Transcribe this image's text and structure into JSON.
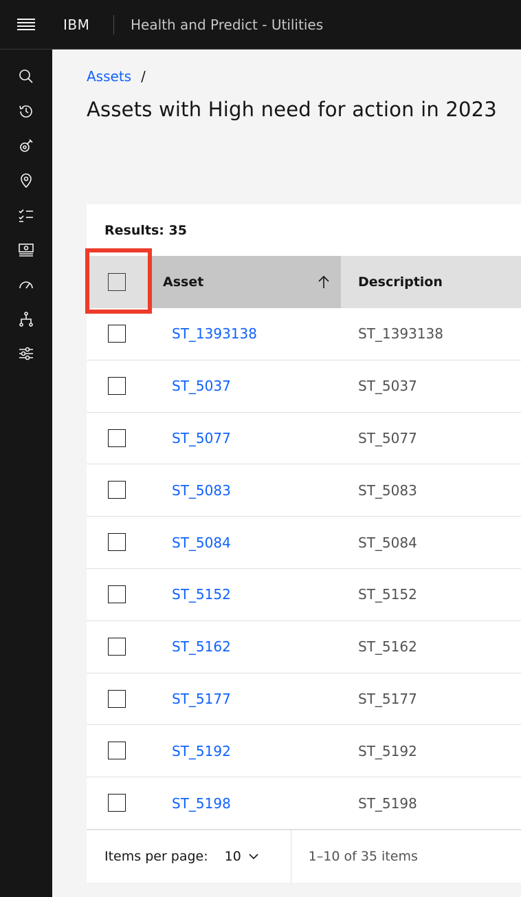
{
  "header": {
    "brand": "IBM",
    "app_title": "Health and Predict - Utilities"
  },
  "sidenav": {
    "items": [
      {
        "icon": "search-icon"
      },
      {
        "icon": "history-icon"
      },
      {
        "icon": "asset-icon"
      },
      {
        "icon": "location-icon"
      },
      {
        "icon": "checklist-icon"
      },
      {
        "icon": "dashboard-icon"
      },
      {
        "icon": "gauge-icon"
      },
      {
        "icon": "hierarchy-icon"
      },
      {
        "icon": "settings-adjust-icon"
      }
    ]
  },
  "breadcrumb": {
    "link": "Assets",
    "separator": "/"
  },
  "page": {
    "title": "Assets with High need for action in 2023"
  },
  "table": {
    "results_label": "Results: 35",
    "columns": [
      "Asset",
      "Description"
    ],
    "sort": "ascending",
    "rows": [
      {
        "asset": "ST_1393138",
        "description": "ST_1393138"
      },
      {
        "asset": "ST_5037",
        "description": "ST_5037"
      },
      {
        "asset": "ST_5077",
        "description": "ST_5077"
      },
      {
        "asset": "ST_5083",
        "description": "ST_5083"
      },
      {
        "asset": "ST_5084",
        "description": "ST_5084"
      },
      {
        "asset": "ST_5152",
        "description": "ST_5152"
      },
      {
        "asset": "ST_5162",
        "description": "ST_5162"
      },
      {
        "asset": "ST_5177",
        "description": "ST_5177"
      },
      {
        "asset": "ST_5192",
        "description": "ST_5192"
      },
      {
        "asset": "ST_5198",
        "description": "ST_5198"
      }
    ]
  },
  "pagination": {
    "items_per_page_label": "Items per page:",
    "items_per_page_value": "10",
    "range_text": "1–10 of 35 items"
  },
  "colors": {
    "header_bg": "#161616",
    "link": "#0f62fe",
    "highlight": "#ee3b2a"
  }
}
